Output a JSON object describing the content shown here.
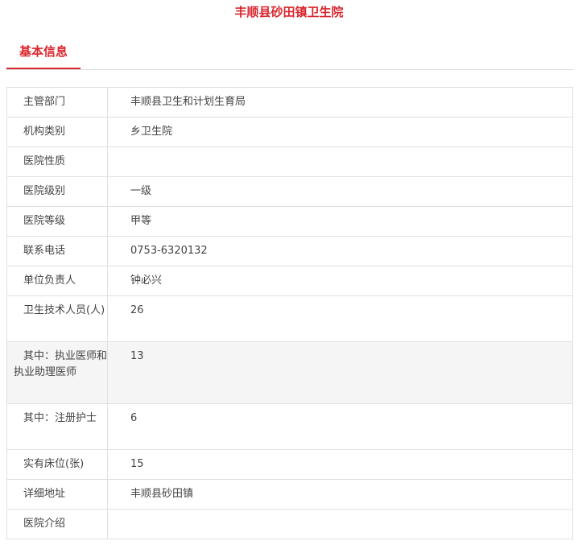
{
  "page": {
    "title": "丰顺县砂田镇卫生院"
  },
  "tabs": {
    "active_label": "基本信息"
  },
  "info_rows": [
    {
      "label": "主管部门",
      "value": "丰顺县卫生和计划生育局"
    },
    {
      "label": "机构类别",
      "value": "乡卫生院"
    },
    {
      "label": "医院性质",
      "value": ""
    },
    {
      "label": "医院级别",
      "value": "一级"
    },
    {
      "label": "医院等级",
      "value": "甲等"
    },
    {
      "label": "联系电话",
      "value": "0753-6320132"
    },
    {
      "label": "单位负责人",
      "value": "钟必兴"
    },
    {
      "label": "卫生技术人员(人)",
      "value": "26"
    },
    {
      "label": "其中：执业医师和执业助理医师",
      "value": "13"
    },
    {
      "label": "其中：注册护士",
      "value": "6"
    },
    {
      "label": "实有床位(张)",
      "value": "15"
    },
    {
      "label": "详细地址",
      "value": "丰顺县砂田镇"
    },
    {
      "label": "医院介绍",
      "value": ""
    }
  ],
  "colors": {
    "accent": "#d9272e",
    "border": "#e0e0e0",
    "shaded_row": "#f5f5f5"
  }
}
